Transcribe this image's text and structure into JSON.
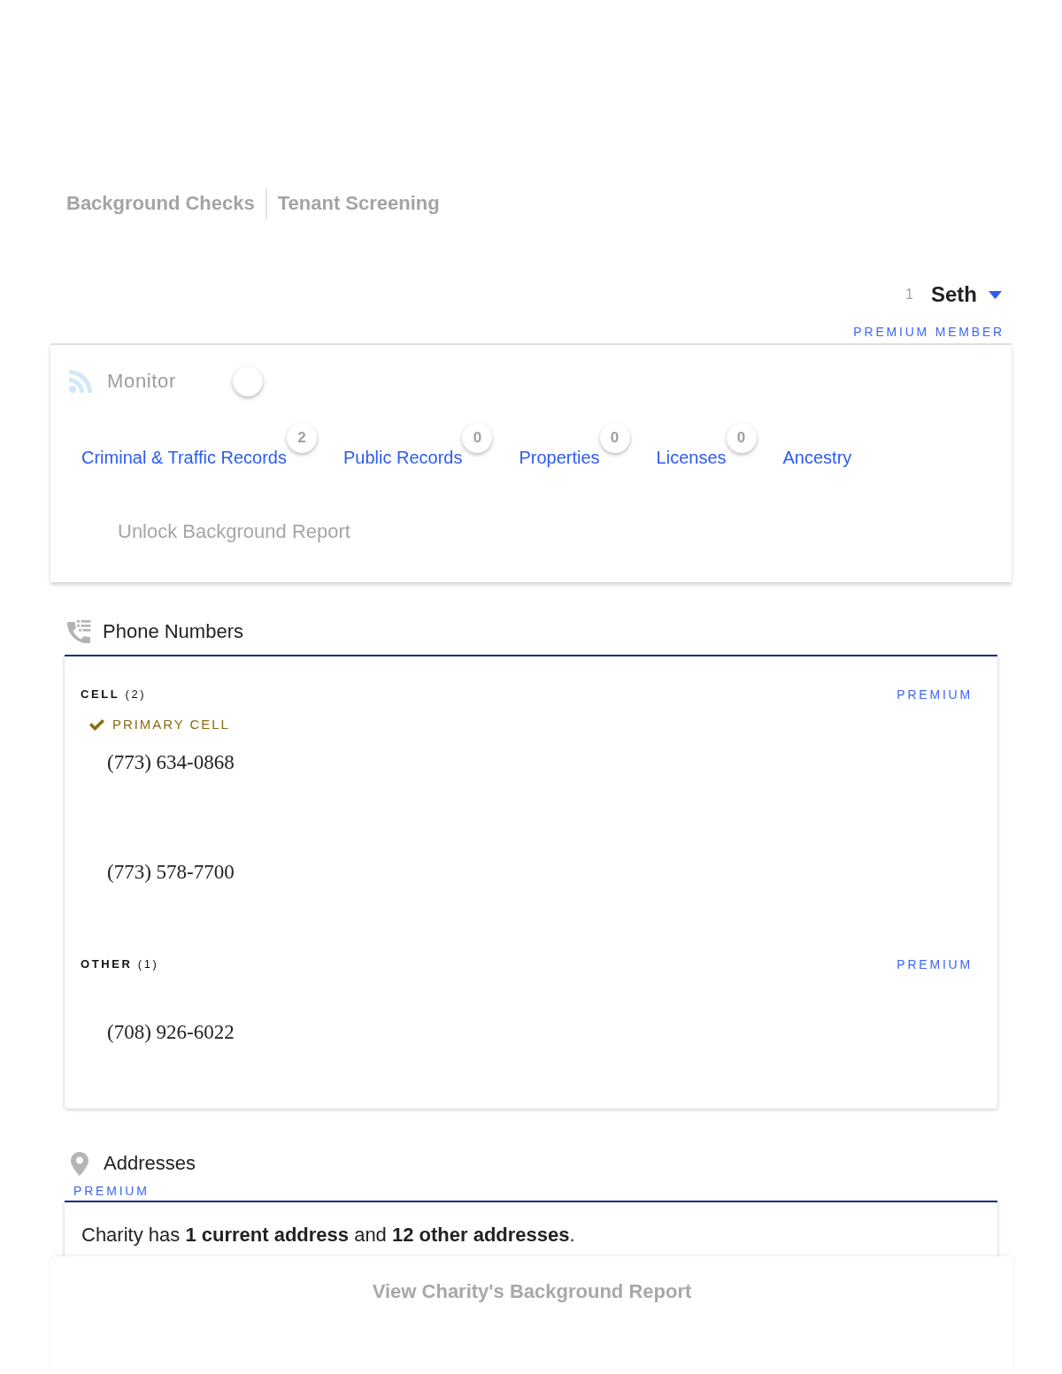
{
  "top_nav": {
    "links": [
      {
        "label": "Background Checks"
      },
      {
        "label": "Tenant Screening"
      }
    ]
  },
  "account": {
    "count": "1",
    "user_name": "Seth",
    "membership": "PREMIUM MEMBER"
  },
  "monitor": {
    "label": "Monitor",
    "on": false
  },
  "report_tabs": [
    {
      "label": "Criminal & Traffic Records",
      "badge": "2"
    },
    {
      "label": "Public Records",
      "badge": "0"
    },
    {
      "label": "Properties",
      "badge": "0"
    },
    {
      "label": "Licenses",
      "badge": "0"
    },
    {
      "label": "Ancestry"
    }
  ],
  "unlock_button": "Unlock Background Report",
  "phone_numbers": {
    "title": "Phone Numbers",
    "groups": [
      {
        "heading": "**CELL** (2)",
        "tag": "PREMIUM",
        "numbers": [
          {
            "number": "(773) 634-0868",
            "primary": true,
            "label": "PRIMARY CELL"
          },
          {
            "number": "(773) 578-7700",
            "primary": false
          }
        ]
      },
      {
        "heading": "**OTHER** (1)",
        "tag": "PREMIUM",
        "numbers": [
          {
            "number": "(708) 926-6022",
            "primary": false
          }
        ]
      }
    ]
  },
  "addresses": {
    "title": "Addresses",
    "tag": "PREMIUM",
    "summary": "Charity has **1 current address** and **12 other addresses**."
  },
  "footer_button": "View Charity's Background Report"
}
